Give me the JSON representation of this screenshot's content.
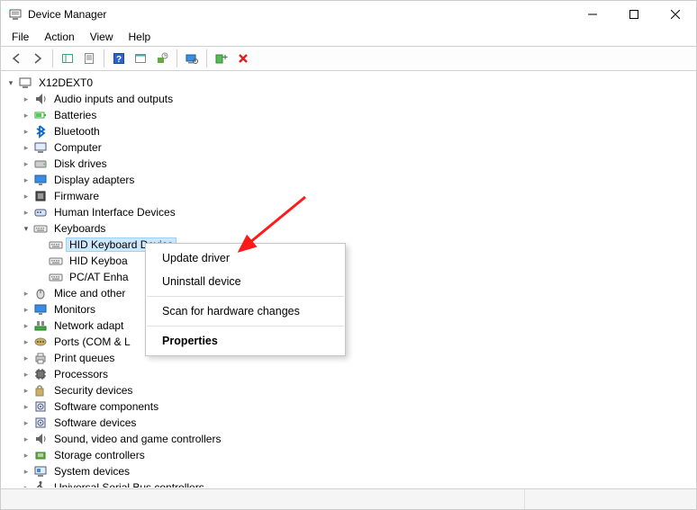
{
  "window": {
    "title": "Device Manager"
  },
  "menubar": [
    "File",
    "Action",
    "View",
    "Help"
  ],
  "tree": {
    "root": "X12DEXT0",
    "categories": [
      {
        "label": "Audio inputs and outputs",
        "icon": "audio"
      },
      {
        "label": "Batteries",
        "icon": "battery"
      },
      {
        "label": "Bluetooth",
        "icon": "bluetooth"
      },
      {
        "label": "Computer",
        "icon": "computer"
      },
      {
        "label": "Disk drives",
        "icon": "disk"
      },
      {
        "label": "Display adapters",
        "icon": "display"
      },
      {
        "label": "Firmware",
        "icon": "firmware"
      },
      {
        "label": "Human Interface Devices",
        "icon": "hid"
      },
      {
        "label": "Keyboards",
        "icon": "keyboard",
        "expanded": true,
        "children": [
          {
            "label": "HID Keyboard Device",
            "icon": "keyboard",
            "selected": true
          },
          {
            "label": "HID Keyboa",
            "icon": "keyboard"
          },
          {
            "label": "PC/AT Enha",
            "icon": "keyboard"
          }
        ]
      },
      {
        "label": "Mice and other",
        "icon": "mouse"
      },
      {
        "label": "Monitors",
        "icon": "monitor"
      },
      {
        "label": "Network adapt",
        "icon": "network"
      },
      {
        "label": "Ports (COM & L",
        "icon": "ports"
      },
      {
        "label": "Print queues",
        "icon": "printer"
      },
      {
        "label": "Processors",
        "icon": "cpu"
      },
      {
        "label": "Security devices",
        "icon": "security"
      },
      {
        "label": "Software components",
        "icon": "software"
      },
      {
        "label": "Software devices",
        "icon": "software"
      },
      {
        "label": "Sound, video and game controllers",
        "icon": "sound"
      },
      {
        "label": "Storage controllers",
        "icon": "storage"
      },
      {
        "label": "System devices",
        "icon": "system"
      },
      {
        "label": "Universal Serial Bus controllers",
        "icon": "usb"
      }
    ]
  },
  "context_menu": {
    "items": [
      {
        "label": "Update driver"
      },
      {
        "label": "Uninstall device"
      },
      {
        "sep": true
      },
      {
        "label": "Scan for hardware changes"
      },
      {
        "sep": true
      },
      {
        "label": "Properties",
        "bold": true
      }
    ]
  }
}
